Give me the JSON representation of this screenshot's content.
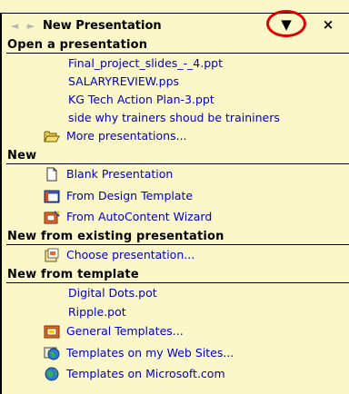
{
  "pane": {
    "title": "New Presentation",
    "back_glyph": "◄",
    "forward_glyph": "►",
    "dropdown_glyph": "▼",
    "close_glyph": "×"
  },
  "sections": {
    "open": {
      "heading": "Open a presentation",
      "files": [
        "Final_project_slides_-_4.ppt",
        "SALARYREVIEW.pps",
        "KG Tech Action Plan-3.ppt",
        "side why trainers shoud be traininers"
      ],
      "more": "More presentations..."
    },
    "new": {
      "heading": "New",
      "blank": "Blank Presentation",
      "design": "From Design Template",
      "autocontent": "From AutoContent Wizard"
    },
    "existing": {
      "heading": "New from existing presentation",
      "choose": "Choose presentation..."
    },
    "template": {
      "heading": "New from template",
      "files": [
        "Digital Dots.pot",
        "Ripple.pot"
      ],
      "general": "General Templates...",
      "websites": "Templates on my Web Sites...",
      "microsoft": "Templates on Microsoft.com"
    }
  },
  "colors": {
    "background": "#fbf7c8",
    "link": "#0000c8",
    "highlight_ring": "#e00000"
  }
}
